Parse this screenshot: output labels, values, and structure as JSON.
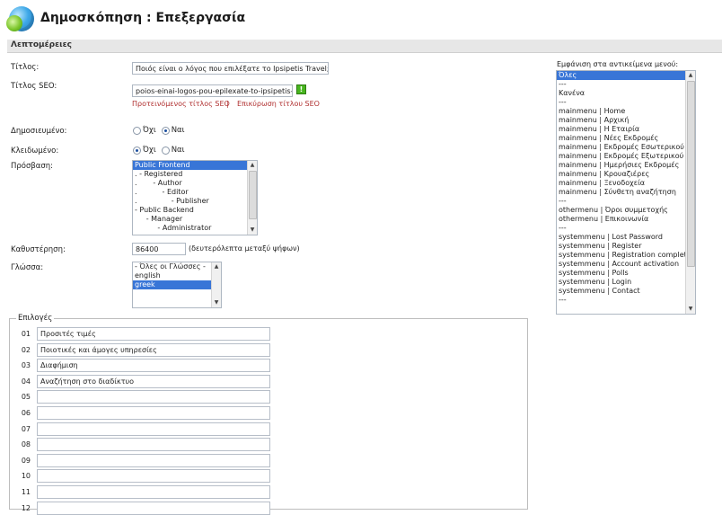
{
  "page": {
    "title": "Δημοσκόπηση : Επεξεργασία"
  },
  "section": {
    "heading": "Λεπτομέρειες"
  },
  "form": {
    "title_label": "Τίτλος:",
    "title_value": "Ποιός είναι ο λόγος που επιλέξατε το Ipsipetis Travel;",
    "seo_label": "Τίτλος SEO:",
    "seo_value": "poios-einai-logos-pou-epilexate-to-ipsipetis-tr",
    "seo_suggest_link": "Προτεινόμενος τίτλος SEO",
    "seo_separator": "|",
    "seo_confirm_link": "Επικύρωση τίτλου SEO",
    "published_label": "Δημοσιευμένο:",
    "locked_label": "Κλειδωμένο:",
    "no_label": "Όχι",
    "yes_label": "Ναι",
    "published_value": "Ναι",
    "locked_value": "Όχι",
    "access_label": "Πρόσβαση:",
    "access_options": [
      "Public Frontend",
      ". - Registered",
      ".       - Author",
      ".           - Editor",
      ".               - Publisher",
      "- Public Backend",
      "     - Manager",
      "          - Administrator"
    ],
    "access_selected": "Public Frontend",
    "delay_label": "Καθυστέρηση:",
    "delay_value": "86400",
    "delay_hint": "(δευτερόλεπτα μεταξύ ψήφων)",
    "language_label": "Γλώσσα:",
    "language_options": [
      "- Όλες οι Γλώσσες -",
      "english",
      "greek"
    ],
    "language_selected": "greek"
  },
  "menu": {
    "label": "Εμφάνιση στα αντικείμενα μενού:",
    "items": [
      "Όλες",
      "---",
      "Κανένα",
      "---",
      "mainmenu | Home",
      "mainmenu | Αρχική",
      "mainmenu | Η Εταιρία",
      "mainmenu | Νέες Εκδρομές",
      "mainmenu | Εκδρομές Εσωτερικού",
      "mainmenu | Εκδρομές Εξωτερικού",
      "mainmenu | Ημερήσιες Εκδρομές",
      "mainmenu | Κρουαζιέρες",
      "mainmenu | Ξενοδοχεία",
      "mainmenu | Σύνθετη αναζήτηση",
      "---",
      "othermenu | Όροι συμμετοχής",
      "othermenu | Επικοινωνία",
      "---",
      "systemmenu | Lost Password",
      "systemmenu | Register",
      "systemmenu | Registration complete",
      "systemmenu | Account activation",
      "systemmenu | Polls",
      "systemmenu | Login",
      "systemmenu | Contact",
      "---"
    ],
    "selected": "Όλες"
  },
  "options": {
    "legend": "Επιλογές",
    "rows": [
      {
        "num": "01",
        "value": "Προσιτές τιμές"
      },
      {
        "num": "02",
        "value": "Ποιοτικές και άμογες υπηρεσίες"
      },
      {
        "num": "03",
        "value": "Διαφήμιση"
      },
      {
        "num": "04",
        "value": "Αναζήτηση στο διαδίκτυο"
      },
      {
        "num": "05",
        "value": ""
      },
      {
        "num": "06",
        "value": ""
      },
      {
        "num": "07",
        "value": ""
      },
      {
        "num": "08",
        "value": ""
      },
      {
        "num": "09",
        "value": ""
      },
      {
        "num": "10",
        "value": ""
      },
      {
        "num": "11",
        "value": ""
      },
      {
        "num": "12",
        "value": ""
      }
    ]
  },
  "icons": {
    "logo": "poll-logo-icon",
    "seo_check": "check-icon"
  }
}
